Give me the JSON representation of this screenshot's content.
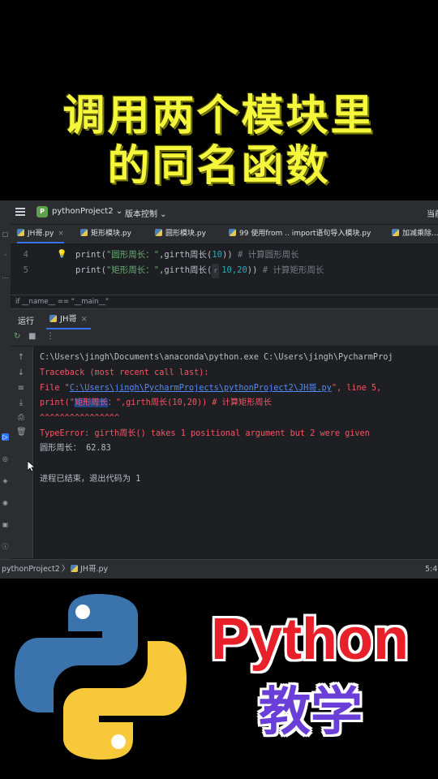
{
  "headline": {
    "line1": "调用两个模块里",
    "line2": "的同名函数"
  },
  "titlebar": {
    "project_badge": "P",
    "project_name": "pythonProject2 ⌄",
    "vcs": "版本控制 ⌄",
    "right_text": "当前"
  },
  "tabs": [
    {
      "label": "JH哥.py",
      "close": "×",
      "active": true
    },
    {
      "label": "矩形模块.py"
    },
    {
      "label": "圆形模块.py"
    },
    {
      "label": "99 使用from .. import语句导入模块.py"
    },
    {
      "label": "加减乘除..."
    }
  ],
  "editor": {
    "lines": [
      {
        "num": "4",
        "prefix": "print(",
        "str": "\"圆形周长：\"",
        "mid": ",girth周长(",
        "args": "10",
        "end": "))",
        "comment": "  # 计算圆形周长"
      },
      {
        "num": "5",
        "prefix": "print(",
        "str": "\"矩形周长：\"",
        "mid": ",girth周长(",
        "hint": "r",
        "args": "10,20",
        "end": "))",
        "comment": "  # 计算矩形周长"
      }
    ],
    "breadcrumb": "if __name__ == \"__main__\""
  },
  "run_panel": {
    "label": "运行",
    "tab_label": "JH哥",
    "tab_close": "×"
  },
  "console": {
    "cmd": "C:\\Users\\jingh\\Documents\\anaconda\\python.exe C:\\Users\\jingh\\PycharmProj",
    "traceback": "Traceback (most recent call last):",
    "file_prefix": "  File \"",
    "file_link": "C:\\Users\\jingh\\PycharmProjects\\pythonProject2\\JH哥.py",
    "file_suffix": "\", line 5,",
    "src_prefix": "    print(\"",
    "src_selected": "矩形周长",
    "src_rest": "：\",girth周长(10,20)) # 计算矩形周长",
    "carets": "             ^^^^^^^^^^^^^^^^",
    "error": "TypeError: girth周长() takes 1 positional argument but 2 were given",
    "output": "圆形周长：  62.83",
    "exit": "进程已结束，退出代码为 1"
  },
  "statusbar": {
    "project": "pythonProject2",
    "sep": "〉",
    "file": "JH哥.py",
    "pos": "5:4"
  },
  "branding": {
    "line1": "Python",
    "line2": "教学"
  },
  "colors": {
    "headline": "#f4f73a",
    "accent": "#3574f0",
    "error": "#f75464",
    "brand_red": "#e8202a",
    "brand_purple": "#6a3fd8"
  }
}
